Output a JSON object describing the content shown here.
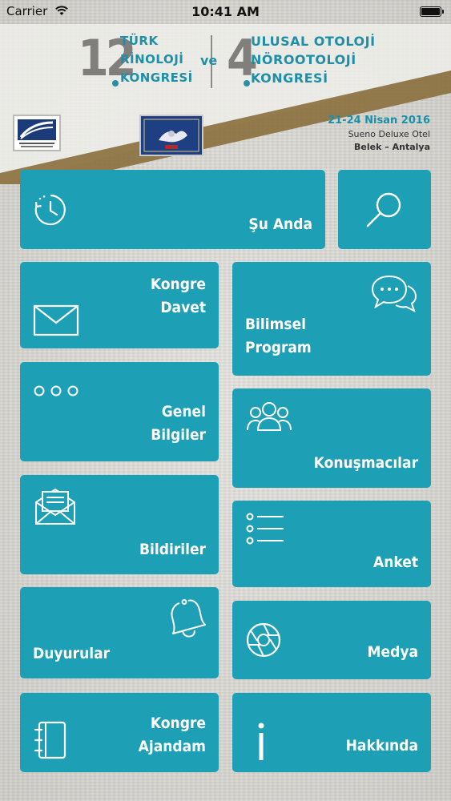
{
  "status_bar": {
    "carrier": "Carrier",
    "time": "10:41 AM"
  },
  "header": {
    "left_number": "12",
    "left_lines": [
      "TÜRK",
      "RİNOLOJİ",
      "KONGRESİ"
    ],
    "connector": "ve",
    "right_number": "4",
    "right_lines": [
      "ULUSAL OTOLOJİ",
      "NÖROOTOLOJİ",
      "KONGRESİ"
    ],
    "date": "21-24 Nisan 2016",
    "venue": "Sueno Deluxe Otel",
    "city": "Belek – Antalya"
  },
  "tiles": [
    {
      "id": "su-anda",
      "lines": [
        "Şu Anda"
      ],
      "icon": "clock-icon"
    },
    {
      "id": "search",
      "lines": [],
      "icon": "search-icon"
    },
    {
      "id": "kongre-davet",
      "lines": [
        "Kongre",
        "Davet"
      ],
      "icon": "envelope-icon"
    },
    {
      "id": "bilimsel-program",
      "lines": [
        "Bilimsel",
        "Program"
      ],
      "icon": "chat-bubbles-icon"
    },
    {
      "id": "genel-bilgiler",
      "lines": [
        "Genel",
        "Bilgiler"
      ],
      "icon": "dots-icon"
    },
    {
      "id": "konusmacilar",
      "lines": [
        "Konuşmacılar"
      ],
      "icon": "people-icon"
    },
    {
      "id": "bildiriler",
      "lines": [
        "Bildiriler"
      ],
      "icon": "letter-icon"
    },
    {
      "id": "anket",
      "lines": [
        "Anket"
      ],
      "icon": "list-icon"
    },
    {
      "id": "duyurular",
      "lines": [
        "Duyurular"
      ],
      "icon": "bell-icon"
    },
    {
      "id": "medya",
      "lines": [
        "Medya"
      ],
      "icon": "aperture-icon"
    },
    {
      "id": "kongre-ajandam",
      "lines": [
        "Kongre",
        "Ajandam"
      ],
      "icon": "notebook-icon"
    },
    {
      "id": "hakkinda",
      "lines": [
        "Hakkında"
      ],
      "icon": "info-icon"
    }
  ]
}
